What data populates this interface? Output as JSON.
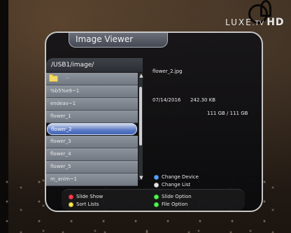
{
  "brand": {
    "name": "LUXE",
    "tv": ".TV",
    "hd": "HD"
  },
  "window": {
    "title": "Image Viewer"
  },
  "browser": {
    "path": "/USB1/image/",
    "items": [
      {
        "label": "..",
        "type": "folder-up"
      },
      {
        "label": "%b5%e9~1"
      },
      {
        "label": "endeav~1"
      },
      {
        "label": "flower_1"
      },
      {
        "label": "flower_2",
        "selected": true
      },
      {
        "label": "flower_3"
      },
      {
        "label": "flower_4"
      },
      {
        "label": "flower_5"
      },
      {
        "label": "m_anim~1"
      }
    ]
  },
  "details": {
    "file_name": "flower_2.jpg",
    "date": "07/14/2016",
    "size": "242.30 KB",
    "storage": "111 GB / 111 GB"
  },
  "hints": {
    "change_device": "Change Device",
    "change_list": "Change List",
    "slide_show": "Slide Show",
    "sort_lists": "Sort Lists",
    "slide_option": "Slide Option",
    "file_option": "File Option"
  },
  "colors": {
    "selected_highlight": "#4266b7",
    "red_key": "#ff3b4b",
    "green_key": "#4cff4c",
    "yellow_key": "#ffe84a",
    "blue_key": "#5aa3ff"
  },
  "icons": {
    "folder": "folder-icon",
    "scroll_up": "chevron-up-icon",
    "scroll_down": "chevron-down-icon"
  }
}
